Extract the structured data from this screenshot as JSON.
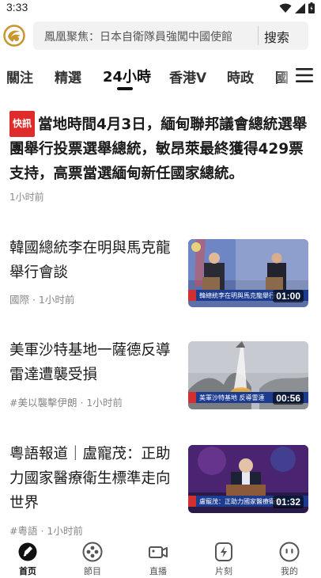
{
  "status_bar": {
    "time": "3:33"
  },
  "search": {
    "placeholder_text": "鳳凰聚焦：日本自衛隊員強闖中國使館",
    "button_label": "搜索"
  },
  "tabs": [
    {
      "label": "關注"
    },
    {
      "label": "精選"
    },
    {
      "label": "24小時",
      "active": true
    },
    {
      "label": "香港V"
    },
    {
      "label": "時政"
    },
    {
      "label": "國"
    }
  ],
  "flash": {
    "badge": "快訊",
    "text": "當地時間4月3日，緬甸聯邦議會總統選舉團舉行投票選舉總統，敏昂萊最終獲得429票支持，高票當選緬甸新任國家總統。",
    "time": "1小时前"
  },
  "news": [
    {
      "title": "韓國總統李在明與馬克龍舉行會談",
      "meta": "國際 · 1小时前",
      "duration": "01:00",
      "caption": "韓總統李在明與馬克龍舉行"
    },
    {
      "title": "美軍沙特基地一薩德反導雷達遭襲受損",
      "meta": "#美以襲擊伊朗 · 1小时前",
      "duration": "00:56",
      "caption": "美軍沙特基地 反導雷達"
    },
    {
      "title": "粵語報道｜盧寵茂：正助力國家醫療衛生標準走向世界",
      "meta": "#粵語 · 1小时前",
      "duration": "01:32",
      "caption": "盧寵茂：正助力國家醫療衛生"
    }
  ],
  "bottom_nav": [
    {
      "label": "首页",
      "icon": "home-icon",
      "active": true
    },
    {
      "label": "節目",
      "icon": "program-icon"
    },
    {
      "label": "直播",
      "icon": "live-icon"
    },
    {
      "label": "片刻",
      "icon": "moment-icon"
    },
    {
      "label": "我的",
      "icon": "profile-icon"
    }
  ],
  "colors": {
    "accent": "#e02b2b",
    "logo": "#c9952c"
  }
}
